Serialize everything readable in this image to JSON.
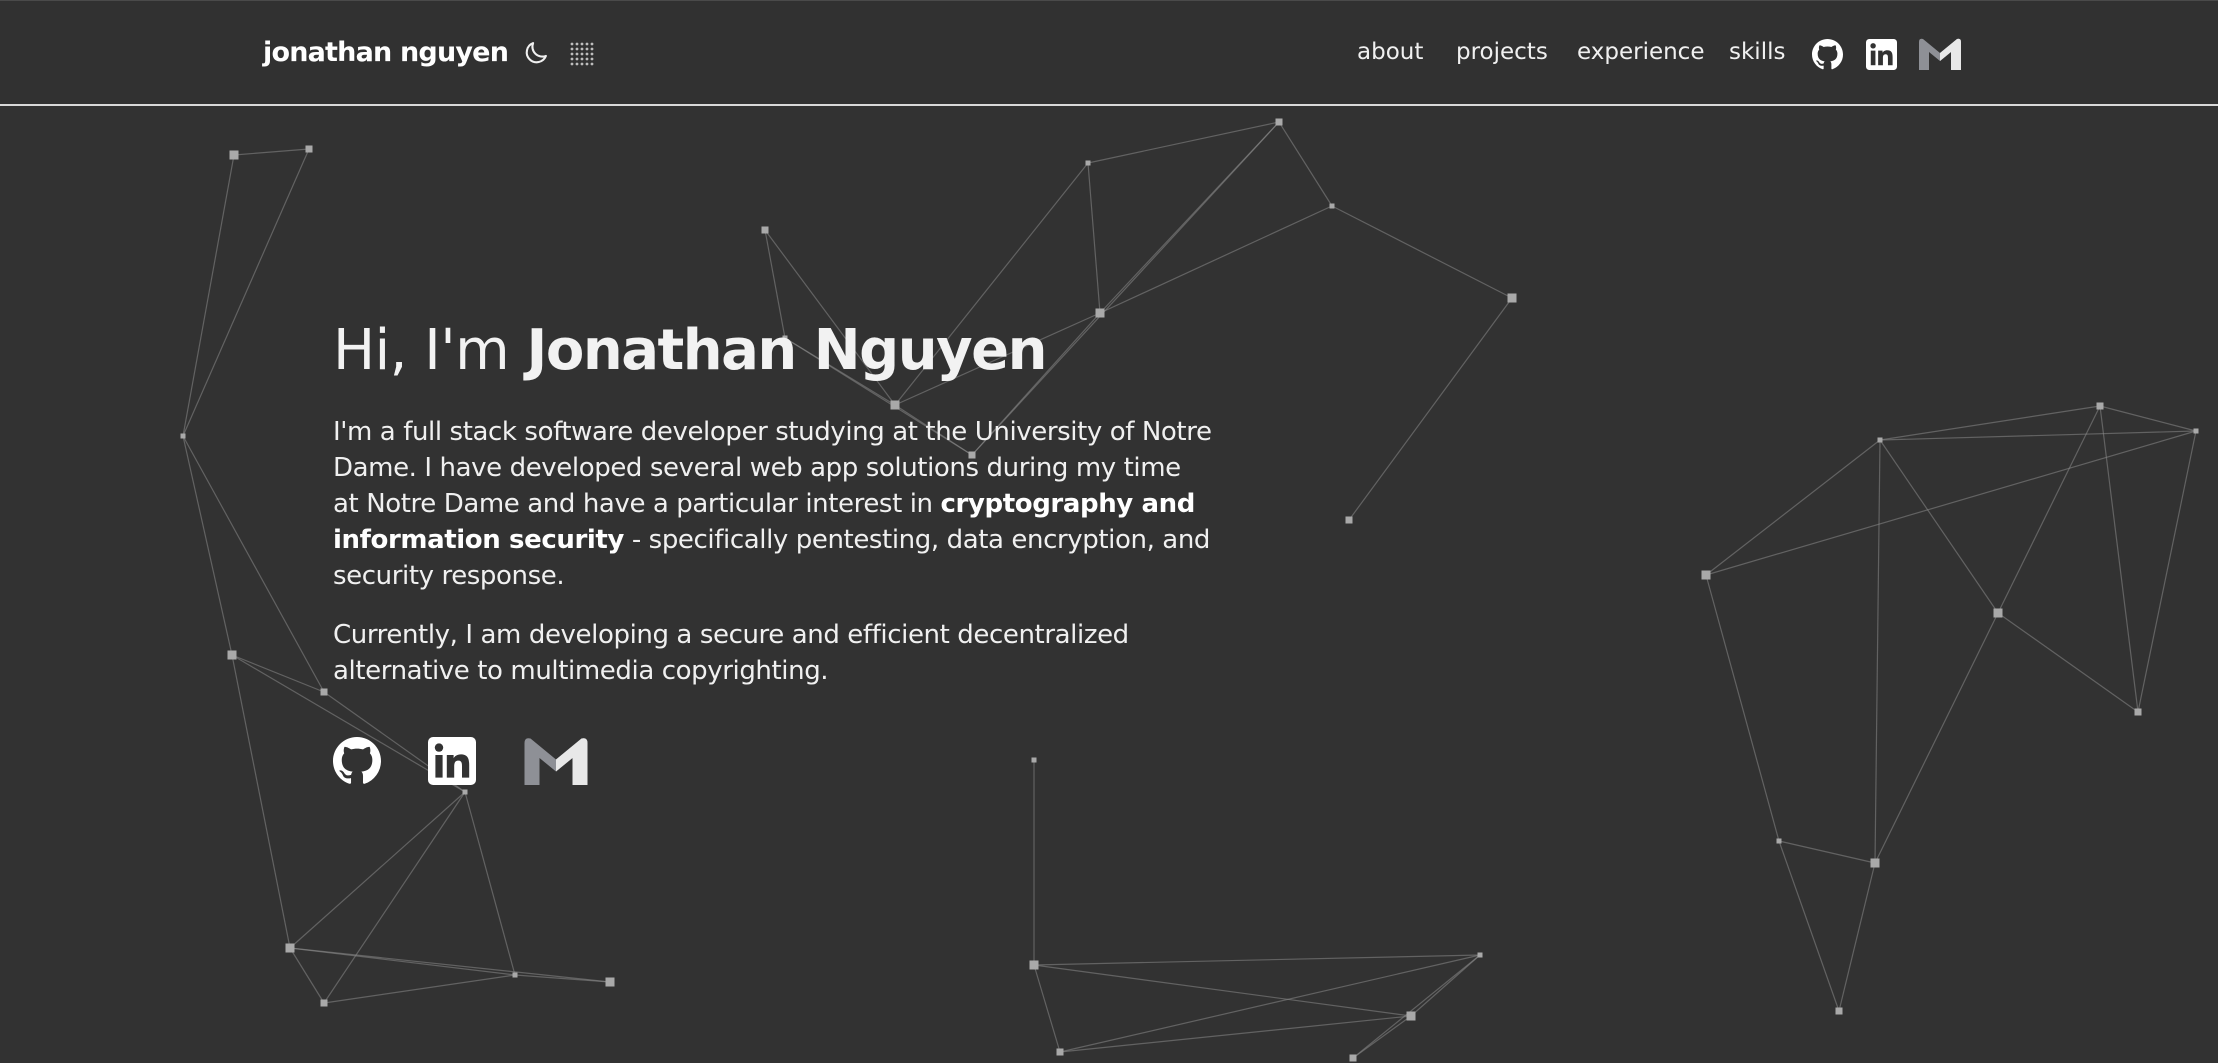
{
  "header": {
    "logo": "jonathan nguyen",
    "theme_toggle_icon": "moon-icon",
    "background_toggle_icon": "dot-grid-icon",
    "nav": [
      "about",
      "projects",
      "experience",
      "skills"
    ],
    "social_icons": [
      "github-icon",
      "linkedin-icon",
      "gmail-icon"
    ]
  },
  "hero": {
    "greeting_prefix": "Hi, I'm ",
    "name": "Jonathan Nguyen",
    "bio1_text1": "I'm a full stack software developer studying at the University of Notre Dame. I have developed several web app solutions during my time at Notre Dame and have a particular interest in ",
    "bio1_bold": "cryptography and information security",
    "bio1_text2": " - specifically pentesting, data encryption, and security response.",
    "bio2": "Currently, I am developing a secure and efficient decentralized alternative to multimedia copyrighting.",
    "social_icons": [
      "github-icon",
      "linkedin-icon",
      "gmail-icon"
    ]
  },
  "colors": {
    "background": "#323232",
    "text": "#f2f2f2",
    "network_line": "#8a8a8a",
    "network_node": "#a9a9a9",
    "gmail_accent": "#8e9096"
  }
}
